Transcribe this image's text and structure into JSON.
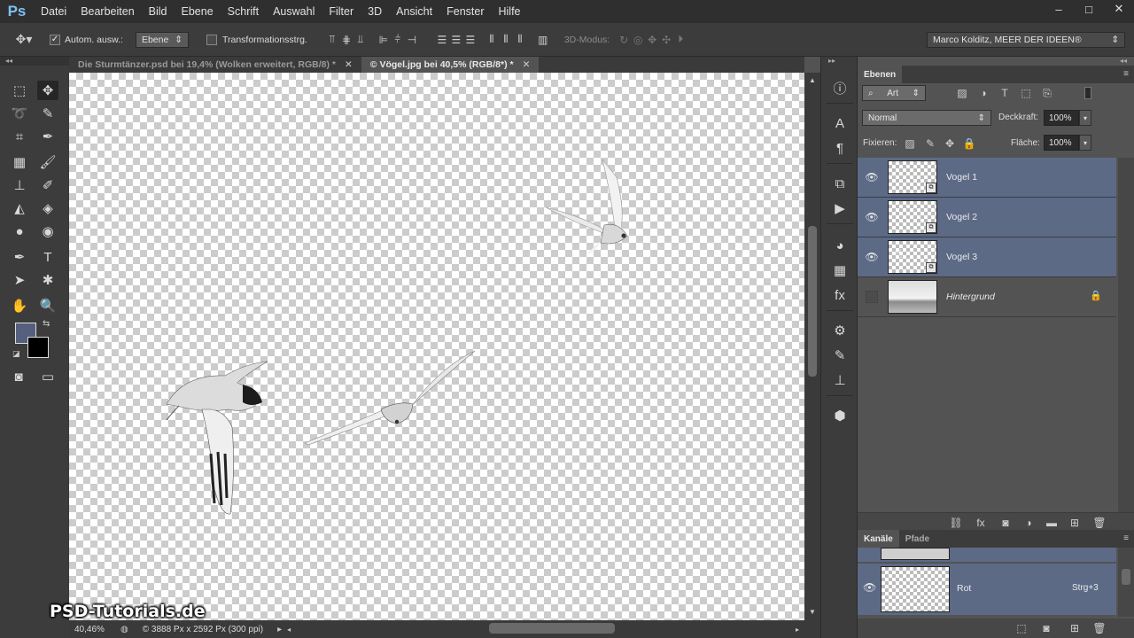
{
  "app": {
    "logo": "Ps",
    "menu": [
      "Datei",
      "Bearbeiten",
      "Bild",
      "Ebene",
      "Schrift",
      "Auswahl",
      "Filter",
      "3D",
      "Ansicht",
      "Fenster",
      "Hilfe"
    ],
    "window_controls": [
      "–",
      "□",
      "✕"
    ]
  },
  "options": {
    "auto_select_label": "Autom. ausw.:",
    "auto_select_checked": true,
    "auto_select_target": "Ebene",
    "transform_label": "Transformationsstrg.",
    "transform_checked": false,
    "mode_3d_label": "3D-Modus:",
    "workspace": "Marco Kolditz, MEER DER IDEEN®"
  },
  "tabs": [
    {
      "title": "Die Sturmtänzer.psd bei 19,4% (Wolken erweitert, RGB/8) *",
      "active": false
    },
    {
      "title": "© Vögel.jpg bei 40,5% (RGB/8*) *",
      "active": true
    }
  ],
  "status": {
    "zoom": "40,46%",
    "doc_info": "© 3888 Px x 2592 Px (300 ppi)"
  },
  "watermark": "PSD-Tutorials.de",
  "layers_panel": {
    "tabs": [
      "Ebenen"
    ],
    "filter_kind": "Art",
    "blend_mode": "Normal",
    "opacity_label": "Deckkraft:",
    "opacity_value": "100%",
    "lock_label": "Fixieren:",
    "fill_label": "Fläche:",
    "fill_value": "100%",
    "layers": [
      {
        "name": "Vogel 1",
        "visible": true,
        "selected": true
      },
      {
        "name": "Vogel 2",
        "visible": true,
        "selected": true
      },
      {
        "name": "Vogel 3",
        "visible": true,
        "selected": true
      },
      {
        "name": "Hintergrund",
        "visible": false,
        "selected": false,
        "locked": true
      }
    ]
  },
  "channels_panel": {
    "tabs": [
      "Kanäle",
      "Pfade"
    ],
    "channels": [
      {
        "name": "Rot",
        "shortcut": "Strg+3"
      }
    ]
  },
  "colors": {
    "foreground": "#55607e",
    "background": "#000000",
    "selection": "#5c6a86"
  }
}
